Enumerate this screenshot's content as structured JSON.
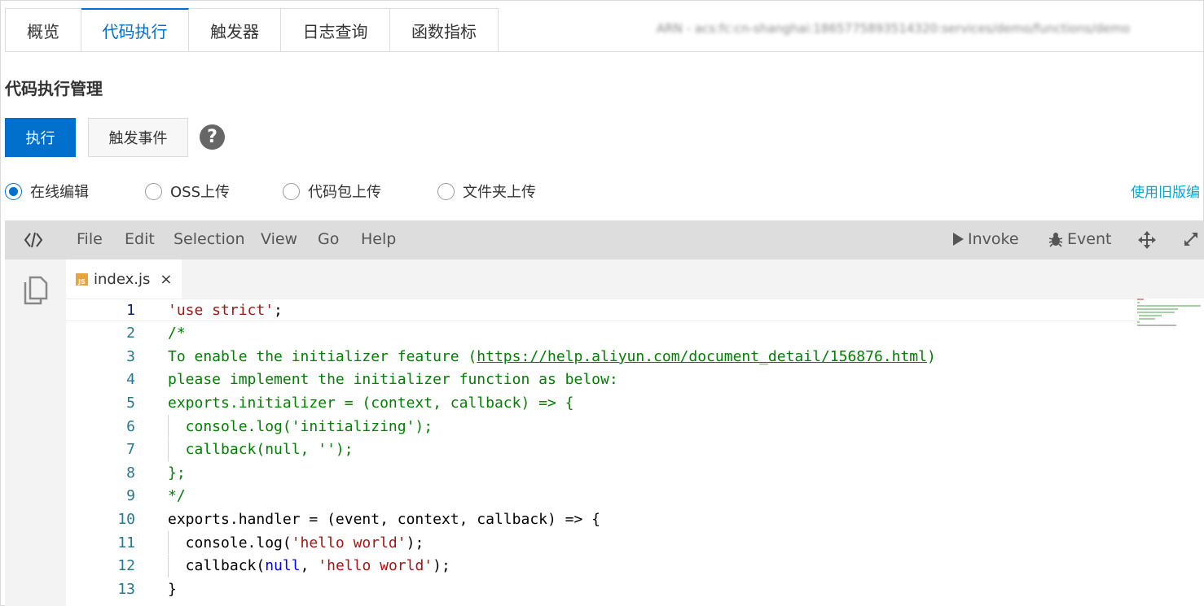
{
  "tabs": [
    {
      "label": "概览",
      "active": false
    },
    {
      "label": "代码执行",
      "active": true
    },
    {
      "label": "触发器",
      "active": false
    },
    {
      "label": "日志查询",
      "active": false
    },
    {
      "label": "函数指标",
      "active": false
    }
  ],
  "arn_text": "ARN - acs:fc:cn-shanghai:1865775893514320:services/demo/functions/demo",
  "section_title": "代码执行管理",
  "buttons": {
    "execute": "执行",
    "trigger_event": "触发事件"
  },
  "help_icon": "question-circle-icon",
  "upload_options": [
    {
      "label": "在线编辑",
      "selected": true
    },
    {
      "label": "OSS上传",
      "selected": false
    },
    {
      "label": "代码包上传",
      "selected": false
    },
    {
      "label": "文件夹上传",
      "selected": false
    }
  ],
  "old_editor_link": "使用旧版编",
  "editor": {
    "menu": [
      "File",
      "Edit",
      "Selection",
      "View",
      "Go",
      "Help"
    ],
    "tools": {
      "invoke": "Invoke",
      "event": "Event"
    },
    "file_tab": {
      "badge": "JS",
      "name": "index.js",
      "close": "×"
    },
    "lines": [
      {
        "n": "1",
        "active": true,
        "indent": false,
        "segments": [
          {
            "t": "'use strict'",
            "c": "red"
          },
          {
            "t": ";",
            "c": "dark"
          }
        ]
      },
      {
        "n": "2",
        "active": false,
        "indent": false,
        "segments": [
          {
            "t": "/*",
            "c": "green"
          }
        ]
      },
      {
        "n": "3",
        "active": false,
        "indent": false,
        "segments": [
          {
            "t": "To enable the initializer feature (",
            "c": "green"
          },
          {
            "t": "https://help.aliyun.com/document_detail/156876.html",
            "c": "green",
            "u": true
          },
          {
            "t": ")",
            "c": "green"
          }
        ]
      },
      {
        "n": "4",
        "active": false,
        "indent": false,
        "segments": [
          {
            "t": "please implement the initializer function as below:",
            "c": "green"
          }
        ]
      },
      {
        "n": "5",
        "active": false,
        "indent": false,
        "segments": [
          {
            "t": "exports.initializer = (context, callback) => {",
            "c": "green"
          }
        ]
      },
      {
        "n": "6",
        "active": false,
        "indent": true,
        "segments": [
          {
            "t": "  console.log('initializing');",
            "c": "green"
          }
        ]
      },
      {
        "n": "7",
        "active": false,
        "indent": true,
        "segments": [
          {
            "t": "  callback(null, '');",
            "c": "green"
          }
        ]
      },
      {
        "n": "8",
        "active": false,
        "indent": false,
        "segments": [
          {
            "t": "};",
            "c": "green"
          }
        ]
      },
      {
        "n": "9",
        "active": false,
        "indent": false,
        "segments": [
          {
            "t": "*/",
            "c": "green"
          }
        ]
      },
      {
        "n": "10",
        "active": false,
        "indent": false,
        "segments": [
          {
            "t": "exports.handler = (event, context, callback) => {",
            "c": "dark"
          }
        ]
      },
      {
        "n": "11",
        "active": false,
        "indent": true,
        "segments": [
          {
            "t": "  console.log(",
            "c": "dark"
          },
          {
            "t": "'hello world'",
            "c": "red"
          },
          {
            "t": ");",
            "c": "dark"
          }
        ]
      },
      {
        "n": "12",
        "active": false,
        "indent": true,
        "segments": [
          {
            "t": "  callback(",
            "c": "dark"
          },
          {
            "t": "null",
            "c": "blue"
          },
          {
            "t": ", ",
            "c": "dark"
          },
          {
            "t": "'hello world'",
            "c": "red"
          },
          {
            "t": ");",
            "c": "dark"
          }
        ]
      },
      {
        "n": "13",
        "active": false,
        "indent": false,
        "segments": [
          {
            "t": "}",
            "c": "dark"
          }
        ]
      }
    ]
  },
  "colors": {
    "primary": "#0070cc",
    "link": "#00a6d6",
    "comment": "#008000",
    "string": "#a31515",
    "keyword": "#0000ff"
  }
}
